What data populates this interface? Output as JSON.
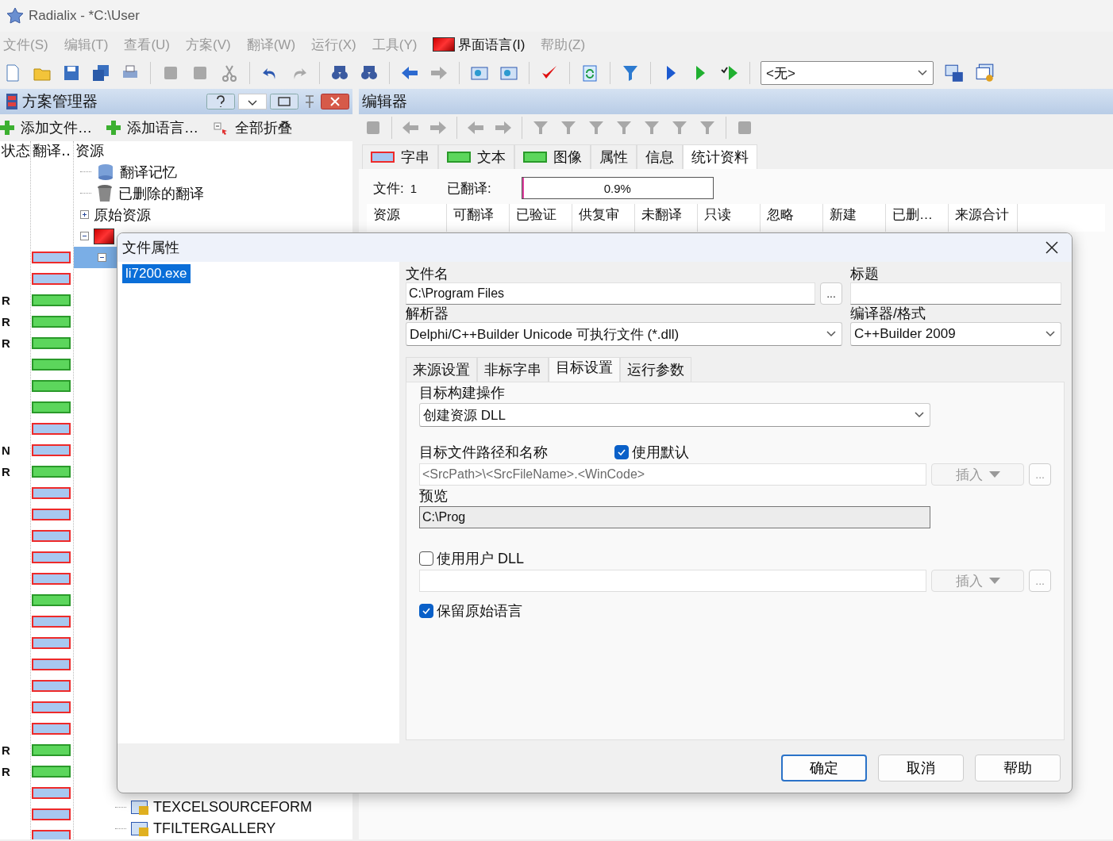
{
  "window": {
    "title": "Radialix - *C:\\User"
  },
  "menu": [
    {
      "label": "文件(S)",
      "disabled": true
    },
    {
      "label": "编辑(T)",
      "disabled": true
    },
    {
      "label": "查看(U)",
      "disabled": true
    },
    {
      "label": "方案(V)",
      "disabled": true
    },
    {
      "label": "翻译(W)",
      "disabled": true
    },
    {
      "label": "运行(X)",
      "disabled": true
    },
    {
      "label": "工具(Y)",
      "disabled": true
    },
    {
      "label": "界面语言(I)",
      "disabled": false,
      "kind": "flag"
    },
    {
      "label": "帮助(Z)",
      "disabled": true
    }
  ],
  "toolbar": {
    "dropdown": {
      "value": "<无>"
    }
  },
  "project_manager": {
    "title": "方案管理器",
    "actions": [
      {
        "label": "添加文件…",
        "kind": "add"
      },
      {
        "label": "添加语言…",
        "kind": "add"
      },
      {
        "label": "全部折叠",
        "kind": "collapse"
      }
    ],
    "columns": [
      "状态",
      "翻译‥",
      "资源"
    ],
    "tree": [
      {
        "label": "翻译记忆",
        "kind": "memory",
        "selected": false
      },
      {
        "label": "已删除的翻译",
        "kind": "deleted",
        "selected": false
      },
      {
        "label": "原始资源",
        "kind": "folder",
        "expanded": false,
        "selected": false
      },
      {
        "kind": "language",
        "expanded": true,
        "selected": false,
        "children": [
          {
            "expanded": true,
            "selected": true,
            "children": [
              {
                "label": "TEXCELSOURCEFORM",
                "kind": "form",
                "selected": false
              },
              {
                "label": "TFILTERGALLERY",
                "kind": "form",
                "selected": false
              }
            ]
          }
        ]
      }
    ],
    "status_rows": [
      {
        "kind": "untranslated"
      },
      {
        "kind": "untranslated"
      },
      {
        "status": "R",
        "kind": "translated"
      },
      {
        "status": "R",
        "kind": "translated"
      },
      {
        "status": "R",
        "kind": "translated"
      },
      {
        "kind": "translated"
      },
      {
        "kind": "translated"
      },
      {
        "kind": "translated"
      },
      {
        "kind": "untranslated"
      },
      {
        "status": "N",
        "kind": "untranslated"
      },
      {
        "status": "R",
        "kind": "translated"
      },
      {
        "kind": "untranslated"
      },
      {
        "kind": "untranslated"
      },
      {
        "kind": "untranslated"
      },
      {
        "kind": "untranslated"
      },
      {
        "kind": "untranslated"
      },
      {
        "kind": "translated"
      },
      {
        "kind": "untranslated"
      },
      {
        "kind": "untranslated"
      },
      {
        "kind": "untranslated"
      },
      {
        "kind": "untranslated"
      },
      {
        "kind": "untranslated"
      },
      {
        "kind": "untranslated"
      },
      {
        "status": "R",
        "kind": "translated"
      },
      {
        "status": "R",
        "kind": "translated"
      },
      {
        "kind": "untranslated"
      },
      {
        "kind": "untranslated"
      },
      {
        "kind": "untranslated"
      }
    ]
  },
  "editor": {
    "title": "编辑器",
    "tabs": [
      {
        "label": "字串",
        "kind": "untranslated",
        "selected": false
      },
      {
        "label": "文本",
        "kind": "translated",
        "selected": false
      },
      {
        "label": "图像",
        "kind": "translated",
        "selected": false
      },
      {
        "label": "属性",
        "selected": false
      },
      {
        "label": "信息",
        "selected": false
      },
      {
        "label": "统计资料",
        "selected": true
      }
    ],
    "files_label": "文件:",
    "files_value": "1",
    "translated_label": "已翻译:",
    "progress": {
      "level": 0.009,
      "reading": "0.9%"
    },
    "table": {
      "columns": [
        "资源",
        "可翻译",
        "已验证",
        "供复审",
        "未翻译",
        "只读",
        "忽略",
        "新建",
        "已删…",
        "来源合计"
      ]
    }
  },
  "dialog": {
    "title": "文件属性",
    "files": [
      {
        "label": "li7200.exe",
        "selected": true
      }
    ],
    "file_name": {
      "label": "文件名",
      "value": "C:\\Program Files",
      "button": "..."
    },
    "caption": {
      "label": "标题"
    },
    "parser": {
      "label": "解析器",
      "value": "Delphi/C++Builder Unicode 可执行文件 (*.dll)"
    },
    "compiler": {
      "label": "编译器/格式",
      "value": "C++Builder 2009"
    },
    "tabs": [
      {
        "label": "来源设置",
        "selected": false
      },
      {
        "label": "非标字串",
        "selected": false
      },
      {
        "label": "目标设置",
        "selected": true
      },
      {
        "label": "运行参数",
        "selected": false
      }
    ],
    "build_action": {
      "label": "目标构建操作",
      "value": "创建资源 DLL"
    },
    "target_path": {
      "label": "目标文件路径和名称",
      "use_default": {
        "label": "使用默认",
        "checked": true
      },
      "value": "<SrcPath>\\<SrcFileName>.<WinCode>",
      "disabled": true,
      "insert": "插入",
      "more": "..."
    },
    "preview": {
      "label": "预览",
      "value": "C:\\Prog"
    },
    "user_dll": {
      "label": "使用用户 DLL",
      "checked": false,
      "disabled": true,
      "insert": "插入",
      "more": "..."
    },
    "keep_original": {
      "label": "保留原始语言",
      "checked": true
    },
    "buttons": [
      {
        "label": "确定",
        "default": true
      },
      {
        "label": "取消",
        "default": false
      },
      {
        "label": "帮助",
        "default": false
      }
    ]
  }
}
